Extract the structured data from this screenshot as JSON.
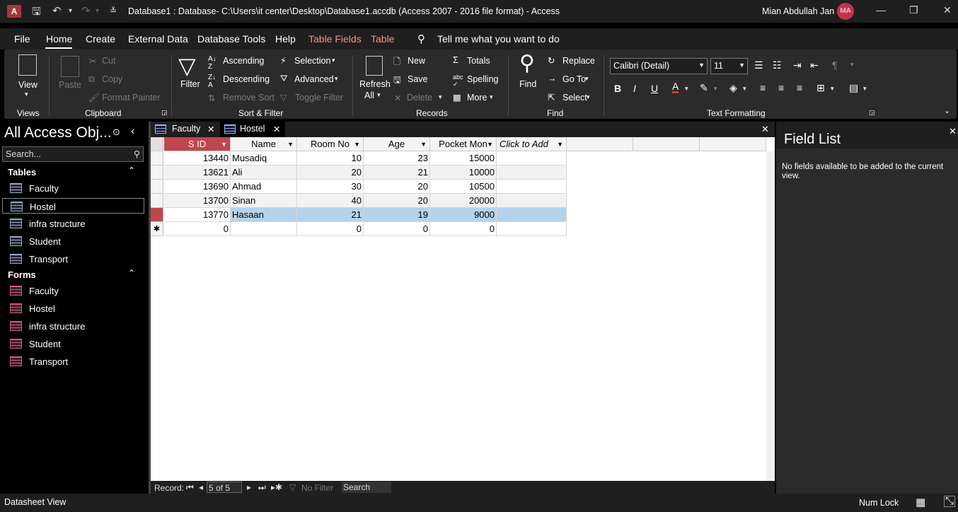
{
  "titlebar": {
    "app_icon": "A",
    "title": "Database1 : Database- C:\\Users\\it center\\Desktop\\Database1.accdb (Access 2007 - 2016 file format)  -  Access",
    "user": "Mian Abdullah Jan",
    "user_initials": "MA"
  },
  "menu": {
    "items": [
      "File",
      "Home",
      "Create",
      "External Data",
      "Database Tools",
      "Help",
      "Table Fields",
      "Table"
    ],
    "active": "Home",
    "tell_me": "Tell me what you want to do"
  },
  "ribbon": {
    "views": {
      "view": "View",
      "group": "Views"
    },
    "clipboard": {
      "paste": "Paste",
      "cut": "Cut",
      "copy": "Copy",
      "format_painter": "Format Painter",
      "group": "Clipboard"
    },
    "sort_filter": {
      "filter": "Filter",
      "ascending": "Ascending",
      "descending": "Descending",
      "remove_sort": "Remove Sort",
      "selection": "Selection",
      "advanced": "Advanced",
      "toggle_filter": "Toggle Filter",
      "group": "Sort & Filter"
    },
    "records": {
      "refresh": "Refresh",
      "refresh_all": "All",
      "new": "New",
      "save": "Save",
      "delete": "Delete",
      "totals": "Totals",
      "spelling": "Spelling",
      "more": "More",
      "group": "Records"
    },
    "find": {
      "find": "Find",
      "replace": "Replace",
      "go_to": "Go To",
      "select": "Select",
      "group": "Find"
    },
    "text_formatting": {
      "font": "Calibri (Detail)",
      "size": "11",
      "bold": "B",
      "italic": "I",
      "underline": "U",
      "font_color": "A",
      "group": "Text Formatting"
    }
  },
  "nav": {
    "header": "All Access Obj...",
    "search_placeholder": "Search...",
    "tables_label": "Tables",
    "tables": [
      "Faculty",
      "Hostel",
      "infra structure",
      "Student",
      "Transport"
    ],
    "forms_label": "Forms",
    "forms": [
      "Faculty",
      "Hostel",
      "infra structure",
      "Student",
      "Transport"
    ],
    "selected": "Hostel"
  },
  "tabs": [
    {
      "label": "Faculty"
    },
    {
      "label": "Hostel"
    }
  ],
  "datasheet": {
    "columns": [
      "S ID",
      "Name",
      "Room No",
      "Age",
      "Pocket Mon",
      "Click to Add"
    ],
    "rows": [
      [
        "13440",
        "Musadiq",
        "10",
        "23",
        "15000"
      ],
      [
        "13621",
        "Ali",
        "20",
        "21",
        "10000"
      ],
      [
        "13690",
        "Ahmad",
        "30",
        "20",
        "10500"
      ],
      [
        "13700",
        "Sinan",
        "40",
        "20",
        "20000"
      ],
      [
        "13770",
        "Hasaan",
        "21",
        "19",
        "9000"
      ]
    ],
    "new_row": [
      "0",
      "",
      "0",
      "0",
      "0"
    ],
    "new_row_marker": "✱",
    "selected_row_index": 4
  },
  "record_nav": {
    "label": "Record:",
    "position": "5 of 5",
    "no_filter": "No Filter",
    "search": "Search"
  },
  "field_list": {
    "title": "Field List",
    "message": "No fields available to be added to the current view."
  },
  "status": {
    "left": "Datasheet View",
    "num_lock": "Num Lock"
  },
  "colors": {
    "accent": "#c0474d",
    "selected_row": "#b4d3ec",
    "context_tab": "#ff8b8b"
  }
}
